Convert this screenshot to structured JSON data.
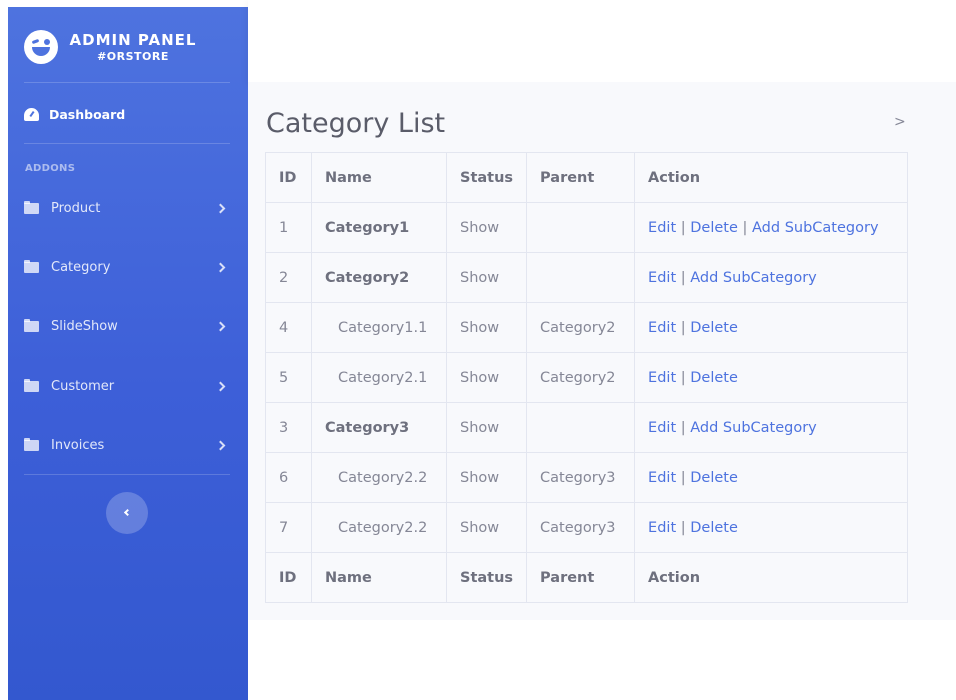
{
  "brand": {
    "title": "ADMIN PANEL",
    "subtitle": "#ORSTORE"
  },
  "sidebar": {
    "dashboard": "Dashboard",
    "section": "ADDONS",
    "items": [
      {
        "label": "Product"
      },
      {
        "label": "Category"
      },
      {
        "label": "SlideShow"
      },
      {
        "label": "Customer"
      },
      {
        "label": "Invoices"
      }
    ]
  },
  "page": {
    "title": "Category List",
    "breadcrumb": ">"
  },
  "table": {
    "headers": [
      "ID",
      "Name",
      "Status",
      "Parent",
      "Action"
    ],
    "rows": [
      {
        "id": "1",
        "name": "Category1",
        "status": "Show",
        "parent": "",
        "top": true,
        "actions": [
          "Edit",
          "Delete",
          "Add SubCategory"
        ]
      },
      {
        "id": "2",
        "name": "Category2",
        "status": "Show",
        "parent": "",
        "top": true,
        "actions": [
          "Edit",
          "Add SubCategory"
        ]
      },
      {
        "id": "4",
        "name": "Category1.1",
        "status": "Show",
        "parent": "Category2",
        "top": false,
        "actions": [
          "Edit",
          "Delete"
        ]
      },
      {
        "id": "5",
        "name": "Category2.1",
        "status": "Show",
        "parent": "Category2",
        "top": false,
        "actions": [
          "Edit",
          "Delete"
        ]
      },
      {
        "id": "3",
        "name": "Category3",
        "status": "Show",
        "parent": "",
        "top": true,
        "actions": [
          "Edit",
          "Add SubCategory"
        ]
      },
      {
        "id": "6",
        "name": "Category2.2",
        "status": "Show",
        "parent": "Category3",
        "top": false,
        "actions": [
          "Edit",
          "Delete"
        ]
      },
      {
        "id": "7",
        "name": "Category2.2",
        "status": "Show",
        "parent": "Category3",
        "top": false,
        "actions": [
          "Edit",
          "Delete"
        ]
      }
    ],
    "separator": "|"
  },
  "colors": {
    "sidebar": "#4e73df",
    "link": "#4e73df",
    "text": "#858796"
  }
}
